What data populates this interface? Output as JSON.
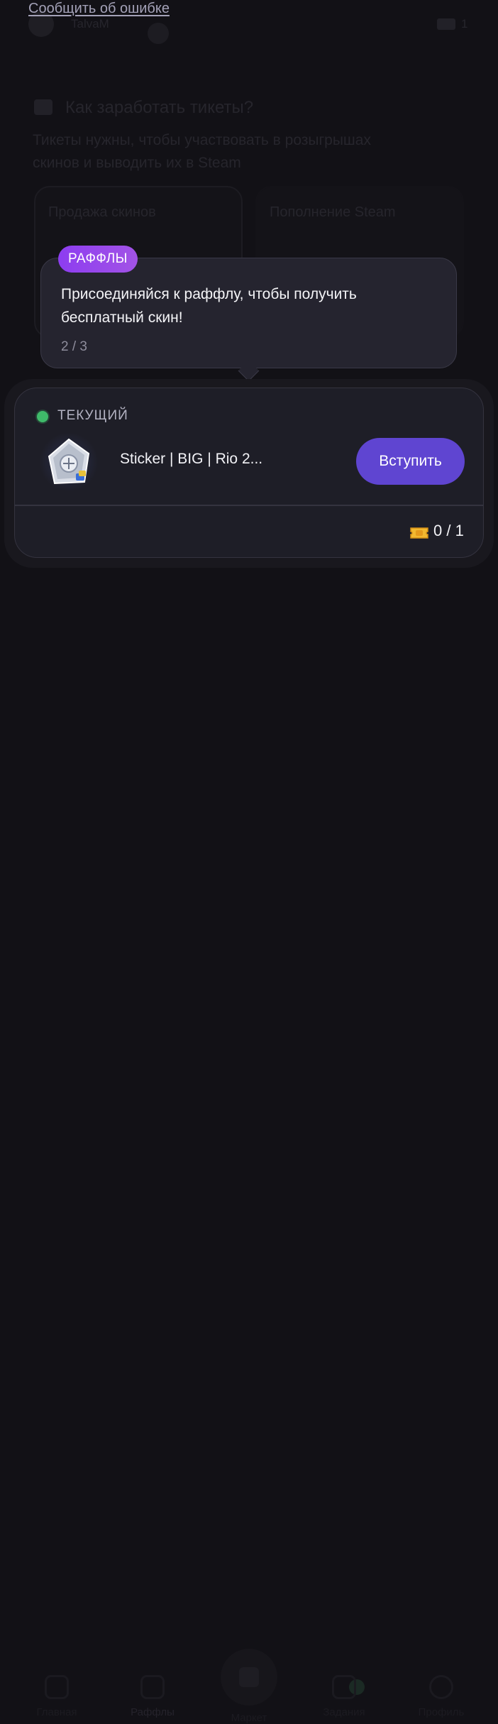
{
  "report_link": "Сообщить об ошибке",
  "background": {
    "username": "TalvaM",
    "ticket_count": "1",
    "heading": "Как заработать тикеты?",
    "description_line1": "Тикеты нужны, чтобы участвовать в розыгрышах",
    "description_line2": "скинов и выводить их в Steam",
    "card_left_label": "Продажа скинов",
    "card_right_label": "Пополнение Steam",
    "nav": {
      "item1": "Главная",
      "item2": "Раффлы",
      "item3": "Маркет",
      "item4": "Задания",
      "item5": "Профиль"
    }
  },
  "tooltip": {
    "badge": "РАФФЛЫ",
    "text": "Присоединяйся к раффлу, чтобы получить бесплатный скин!",
    "counter": "2 / 3"
  },
  "raffle_card": {
    "status": "ТЕКУЩИЙ",
    "status_color": "#3fba6a",
    "item_name": "Sticker | BIG | Rio 2...",
    "join_label": "Вступить",
    "join_color": "#5f45d1",
    "tickets": "0 / 1",
    "ticket_icon": "ticket-icon"
  }
}
